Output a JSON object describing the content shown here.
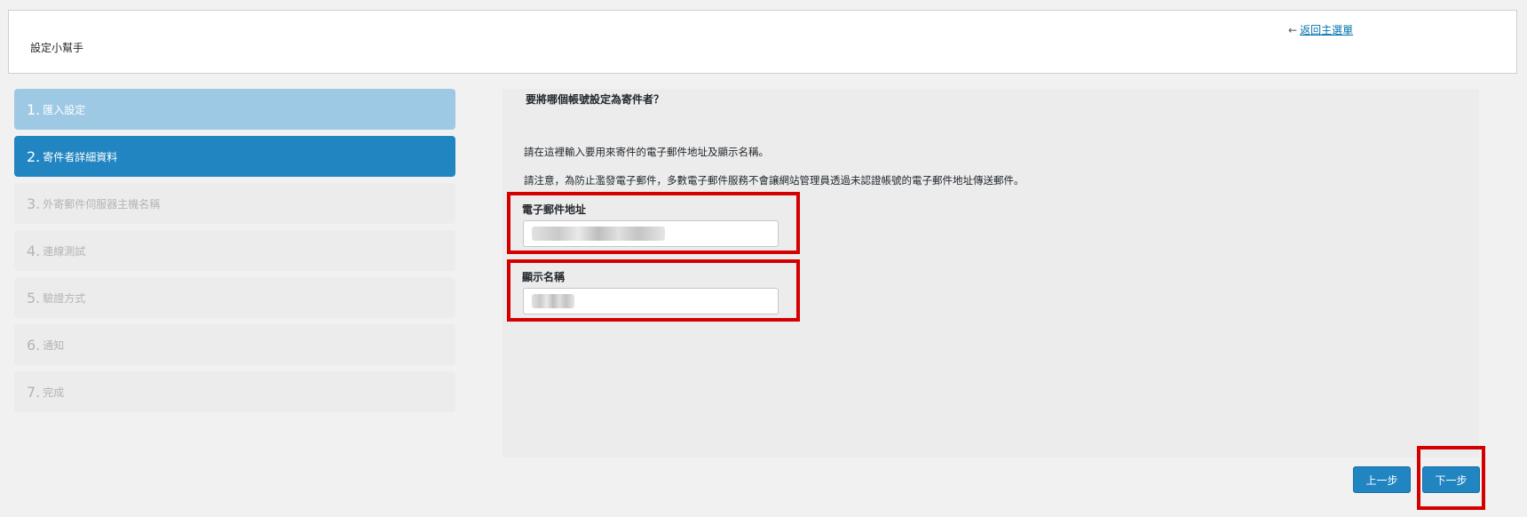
{
  "header": {
    "title": "設定小幫手",
    "back_arrow": "←",
    "back_link": "返回主選單"
  },
  "steps": [
    {
      "num": "1.",
      "label": "匯入設定",
      "state": "done"
    },
    {
      "num": "2.",
      "label": "寄件者詳細資料",
      "state": "active"
    },
    {
      "num": "3.",
      "label": "外寄郵件伺服器主機名稱",
      "state": "pending"
    },
    {
      "num": "4.",
      "label": "連線測試",
      "state": "pending"
    },
    {
      "num": "5.",
      "label": "驗證方式",
      "state": "pending"
    },
    {
      "num": "6.",
      "label": "通知",
      "state": "pending"
    },
    {
      "num": "7.",
      "label": "完成",
      "state": "pending"
    }
  ],
  "content": {
    "question": "要將哪個帳號設定為寄件者？",
    "p1": "請在這裡輸入要用來寄件的電子郵件地址及顯示名稱。",
    "p2": "請注意，為防止濫發電子郵件，多數電子郵件服務不會讓網站管理員透過未認證帳號的電子郵件地址傳送郵件。",
    "email": {
      "label": "電子郵件地址",
      "value": ""
    },
    "display_name": {
      "label": "顯示名稱",
      "value": ""
    }
  },
  "buttons": {
    "prev": "上一步",
    "next": "下一步"
  },
  "colors": {
    "active": "#2185c1",
    "done": "#9ec9e4",
    "highlight": "#d40000"
  }
}
